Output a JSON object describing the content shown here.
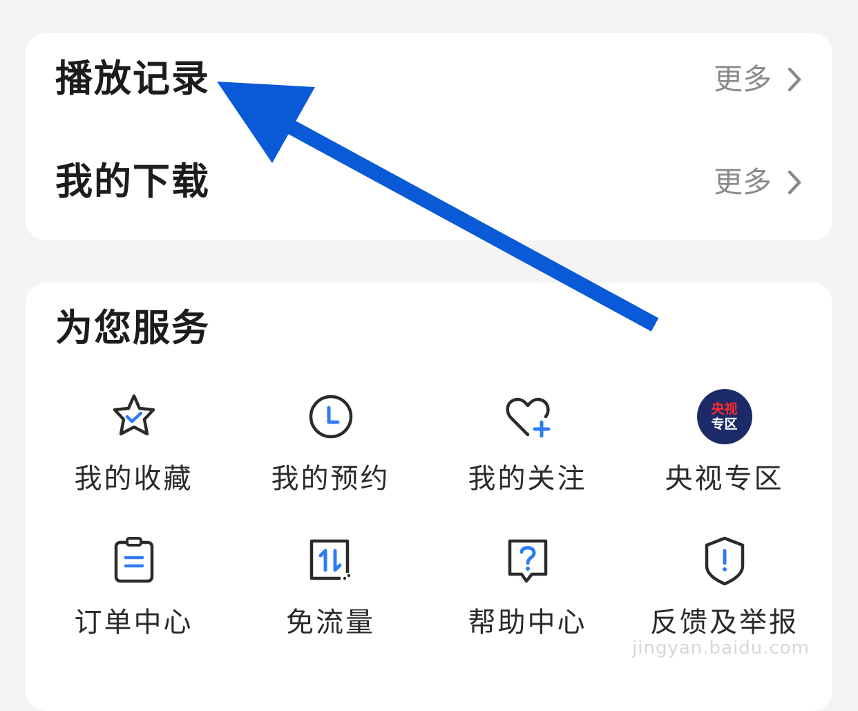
{
  "history_card": {
    "rows": [
      {
        "title": "播放记录",
        "more": "更多"
      },
      {
        "title": "我的下载",
        "more": "更多"
      }
    ]
  },
  "services": {
    "title": "为您服务",
    "items": [
      {
        "label": "我的收藏",
        "icon": "star-check-icon"
      },
      {
        "label": "我的预约",
        "icon": "clock-icon"
      },
      {
        "label": "我的关注",
        "icon": "heart-plus-icon"
      },
      {
        "label": "央视专区",
        "icon": "cctv-badge-icon",
        "badge_line1": "央视",
        "badge_line2": "专区"
      },
      {
        "label": "订单中心",
        "icon": "clipboard-icon"
      },
      {
        "label": "免流量",
        "icon": "data-transfer-icon"
      },
      {
        "label": "帮助中心",
        "icon": "help-bubble-icon"
      },
      {
        "label": "反馈及举报",
        "icon": "shield-alert-icon"
      }
    ]
  },
  "annotation": {
    "arrow_color": "#0a5ad8"
  },
  "colors": {
    "accent": "#2f7bf5",
    "icon_stroke": "#2b2b2b",
    "badge_bg": "#1c2b68"
  },
  "watermark": {
    "text": "jingyan.baidu.com"
  }
}
